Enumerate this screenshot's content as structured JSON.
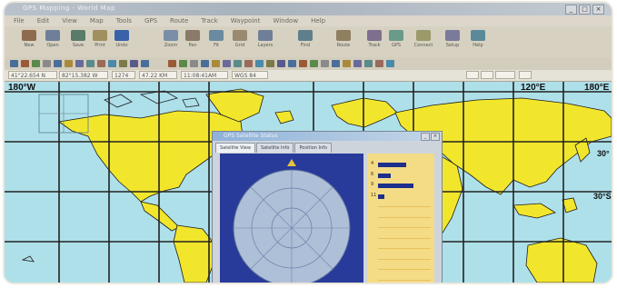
{
  "window": {
    "title": "GPS Mapping - World Map"
  },
  "menu": [
    "File",
    "Edit",
    "View",
    "Map",
    "Tools",
    "GPS",
    "Route",
    "Track",
    "Waypoint",
    "Window",
    "Help"
  ],
  "toolbar": {
    "buttons": [
      "New",
      "Open",
      "Save",
      "Print",
      "Undo",
      "Zoom",
      "Pan",
      "Fit",
      "Grid",
      "Layers",
      "Find",
      "Route",
      "Track",
      "GPS",
      "Connect",
      "Setup",
      "Help"
    ]
  },
  "status": {
    "fields": [
      "41°22.654 N",
      "82°15.382 W",
      "1274",
      "47.22 KM",
      "11:08:41AM",
      "WGS 84"
    ]
  },
  "map": {
    "lon_labels_top": [
      "180°W",
      "",
      "",
      "",
      "",
      "",
      "",
      "",
      "",
      "120°E",
      "180°E"
    ],
    "lat_labels_right": [
      "",
      "30°",
      "30°S",
      ""
    ]
  },
  "dialog": {
    "title": "GPS Satellite Status",
    "tabs": [
      "Satellite View",
      "Satellite Info",
      "Position Info"
    ],
    "sky": {
      "north": "N"
    },
    "signals": [
      {
        "id": "4",
        "strength": 0.55
      },
      {
        "id": "6",
        "strength": 0.25
      },
      {
        "id": "9",
        "strength": 0.7
      },
      {
        "id": "11",
        "strength": 0.12
      },
      {
        "id": "",
        "strength": 0
      },
      {
        "id": "",
        "strength": 0
      },
      {
        "id": "",
        "strength": 0
      },
      {
        "id": "",
        "strength": 0
      },
      {
        "id": "",
        "strength": 0
      },
      {
        "id": "",
        "strength": 0
      },
      {
        "id": "",
        "strength": 0
      },
      {
        "id": "",
        "strength": 0
      }
    ]
  },
  "colors": {
    "water": "#aee0ea",
    "land": "#f2e62c",
    "grid": "#222222",
    "sky": "#283a9a",
    "signal": "#f4db86"
  }
}
